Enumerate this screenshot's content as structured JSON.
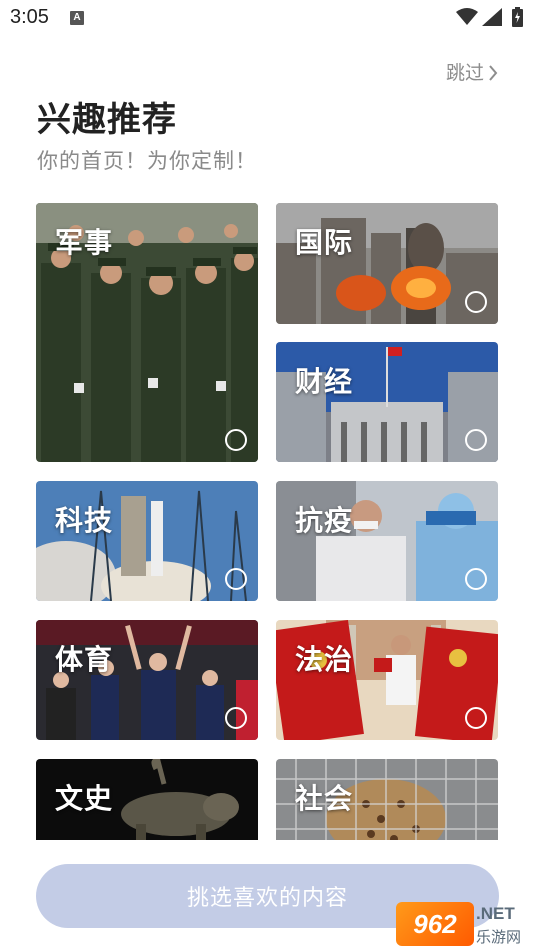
{
  "status_bar": {
    "time": "3:05",
    "notification_icon": "A"
  },
  "skip_label": "跳过",
  "title": "兴趣推荐",
  "subtitle": "你的首页！为你定制！",
  "categories": [
    {
      "label": "军事",
      "selected": false
    },
    {
      "label": "国际",
      "selected": false
    },
    {
      "label": "财经",
      "selected": false
    },
    {
      "label": "科技",
      "selected": false
    },
    {
      "label": "抗疫",
      "selected": false
    },
    {
      "label": "体育",
      "selected": false
    },
    {
      "label": "法治",
      "selected": false
    },
    {
      "label": "文史",
      "selected": false
    },
    {
      "label": "社会",
      "selected": false
    }
  ],
  "pick_button_label": "挑选喜欢的内容",
  "watermark": {
    "logo": "962",
    "net": ".NET",
    "cn": "乐游网"
  },
  "colors": {
    "button_bg": "#c3cce6",
    "title": "#222222",
    "subtitle": "#8a8a8a"
  }
}
